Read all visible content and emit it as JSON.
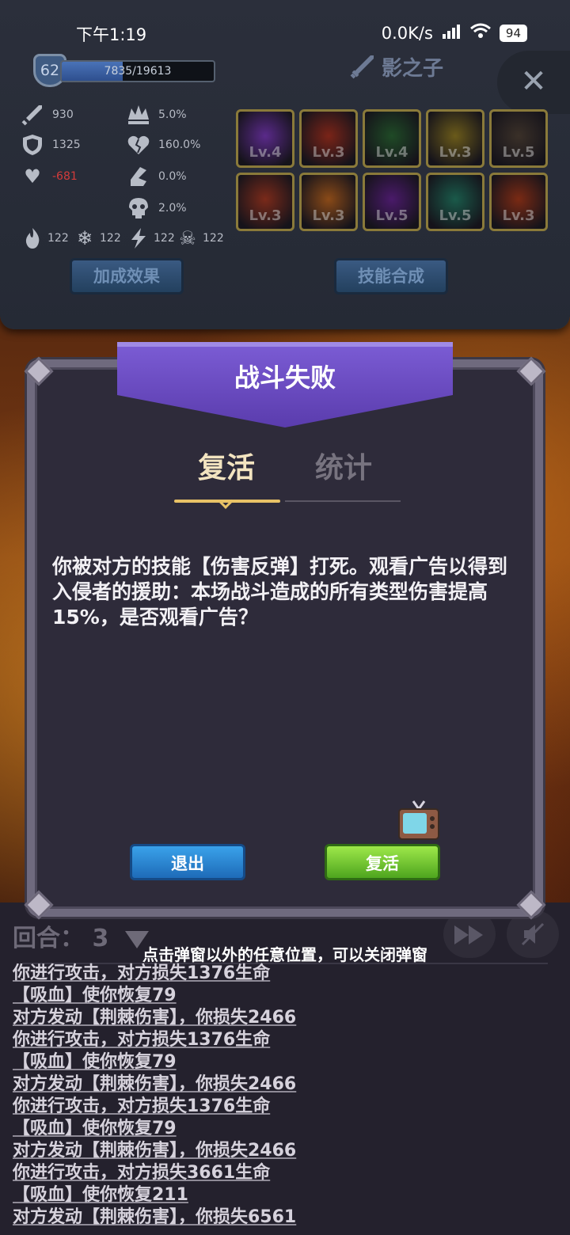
{
  "status_bar": {
    "time": "下午1:19",
    "network_speed": "0.0K/s",
    "battery": "94"
  },
  "player": {
    "level": "62",
    "xp_text": "7835/19613",
    "xp_fraction": 0.4,
    "hero_name": "影之子"
  },
  "stats": {
    "attack": "930",
    "defense": "1325",
    "hp": "-681",
    "crit": "5.0%",
    "crit_damage": "160.0%",
    "dodge": "0.0%",
    "skull_stat": "2.0%",
    "fire": "122",
    "ice": "122",
    "lightning": "122",
    "poison": "122"
  },
  "skills": [
    {
      "level": "Lv.4",
      "color": "#5a2a8a"
    },
    {
      "level": "Lv.3",
      "color": "#7a2418"
    },
    {
      "level": "Lv.4",
      "color": "#1f4a26"
    },
    {
      "level": "Lv.3",
      "color": "#6a5a1a"
    },
    {
      "level": "Lv.5",
      "color": "#3a3028"
    },
    {
      "level": "Lv.3",
      "color": "#7a2a1a"
    },
    {
      "level": "Lv.3",
      "color": "#8a4a18"
    },
    {
      "level": "Lv.5",
      "color": "#4a1a6a"
    },
    {
      "level": "Lv.5",
      "color": "#1a5a4a"
    },
    {
      "level": "Lv.3",
      "color": "#7a2a14"
    }
  ],
  "panel_buttons": {
    "bonus": "加成效果",
    "synthesis": "技能合成"
  },
  "dialog": {
    "title": "战斗失败",
    "tab_revive": "复活",
    "tab_stats": "统计",
    "message": "你被对方的技能【伤害反弹】打死。观看广告以得到入侵者的援助：本场战斗造成的所有类型伤害提高15%，是否观看广告？",
    "exit_label": "退出",
    "revive_label": "复活"
  },
  "bottom": {
    "round_label": "回合：",
    "round_value": "3",
    "hint": "点击弹窗以外的任意位置，可以关闭弹窗",
    "log": [
      "你进行攻击，对方损失1376生命",
      "【吸血】使你恢复79",
      "对方发动【荆棘伤害】，你损失2466",
      "你进行攻击，对方损失1376生命",
      "【吸血】使你恢复79",
      "对方发动【荆棘伤害】，你损失2466",
      "你进行攻击，对方损失1376生命",
      "【吸血】使你恢复79",
      "对方发动【荆棘伤害】，你损失2466",
      "你进行攻击，对方损失3661生命",
      "【吸血】使你恢复211",
      "对方发动【荆棘伤害】，你损失6561"
    ]
  }
}
